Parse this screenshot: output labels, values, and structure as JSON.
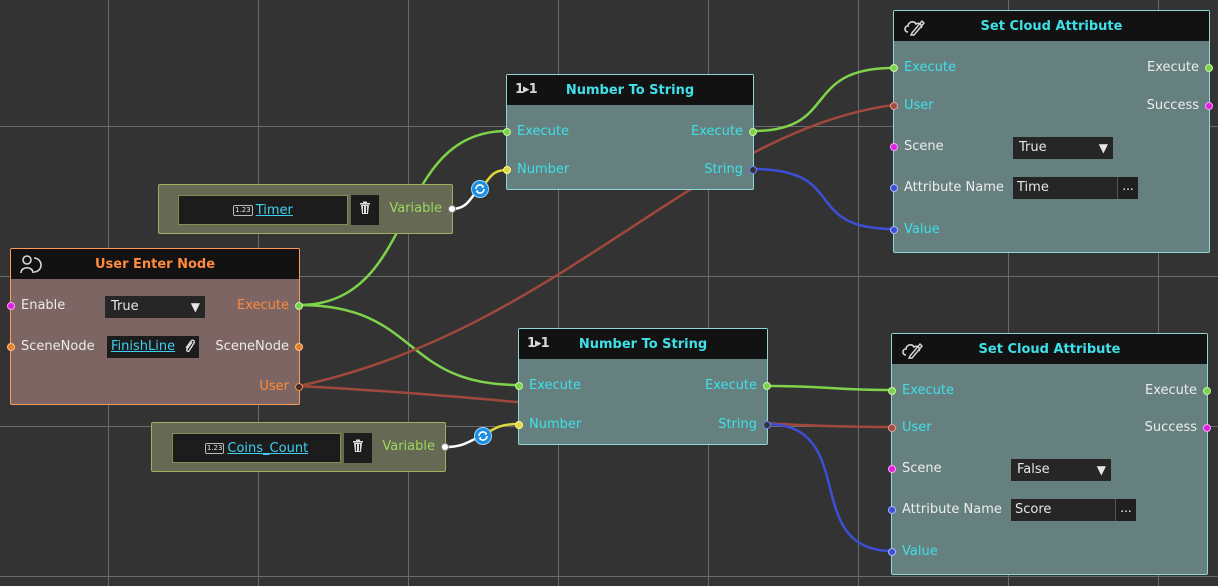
{
  "set_cloud_1": {
    "title": "Set Cloud Attribute",
    "in_execute": "Execute",
    "in_user": "User",
    "in_scene": "Scene",
    "scene_value": "True",
    "in_attribute_name": "Attribute Name",
    "attribute_name_value": "Time",
    "in_value": "Value",
    "out_execute": "Execute",
    "out_success": "Success",
    "dots": "..."
  },
  "set_cloud_2": {
    "title": "Set Cloud Attribute",
    "in_execute": "Execute",
    "in_user": "User",
    "in_scene": "Scene",
    "scene_value": "False",
    "in_attribute_name": "Attribute Name",
    "attribute_name_value": "Score",
    "in_value": "Value",
    "out_execute": "Execute",
    "out_success": "Success",
    "dots": "..."
  },
  "number_to_string_1": {
    "title": "Number To String",
    "icon_text": "1▸1",
    "in_execute": "Execute",
    "in_number": "Number",
    "out_execute": "Execute",
    "out_string": "String"
  },
  "number_to_string_2": {
    "title": "Number To String",
    "icon_text": "1▸1",
    "in_execute": "Execute",
    "in_number": "Number",
    "out_execute": "Execute",
    "out_string": "String"
  },
  "user_enter_node": {
    "title": "User Enter Node",
    "in_enable": "Enable",
    "enable_value": "True",
    "in_scenenode": "SceneNode",
    "scenenode_value": "FinishLine",
    "out_execute": "Execute",
    "out_scenenode": "SceneNode",
    "out_user": "User"
  },
  "variable_timer": {
    "badge": "1.23",
    "name": "Timer",
    "out_label": "Variable"
  },
  "variable_coins": {
    "badge": "1.23",
    "name": "Coins_Count",
    "out_label": "Variable"
  },
  "colors": {
    "canvas": "#333333",
    "execute_wire": "#7fd34a",
    "user_wire": "#a0483c",
    "string_wire": "#3d4fd6",
    "number_wire": "#e0d83a",
    "node_title": "#3fe0e8",
    "event_title": "#ff8a3c"
  },
  "icons": {
    "set_cloud": "cloud-edit-icon",
    "number_to_string": "number-to-string-icon",
    "user_enter": "user-enter-icon",
    "delete": "trash-icon",
    "attach": "paperclip-icon",
    "convert": "refresh-icon",
    "dropdown": "triangle-down-icon"
  }
}
